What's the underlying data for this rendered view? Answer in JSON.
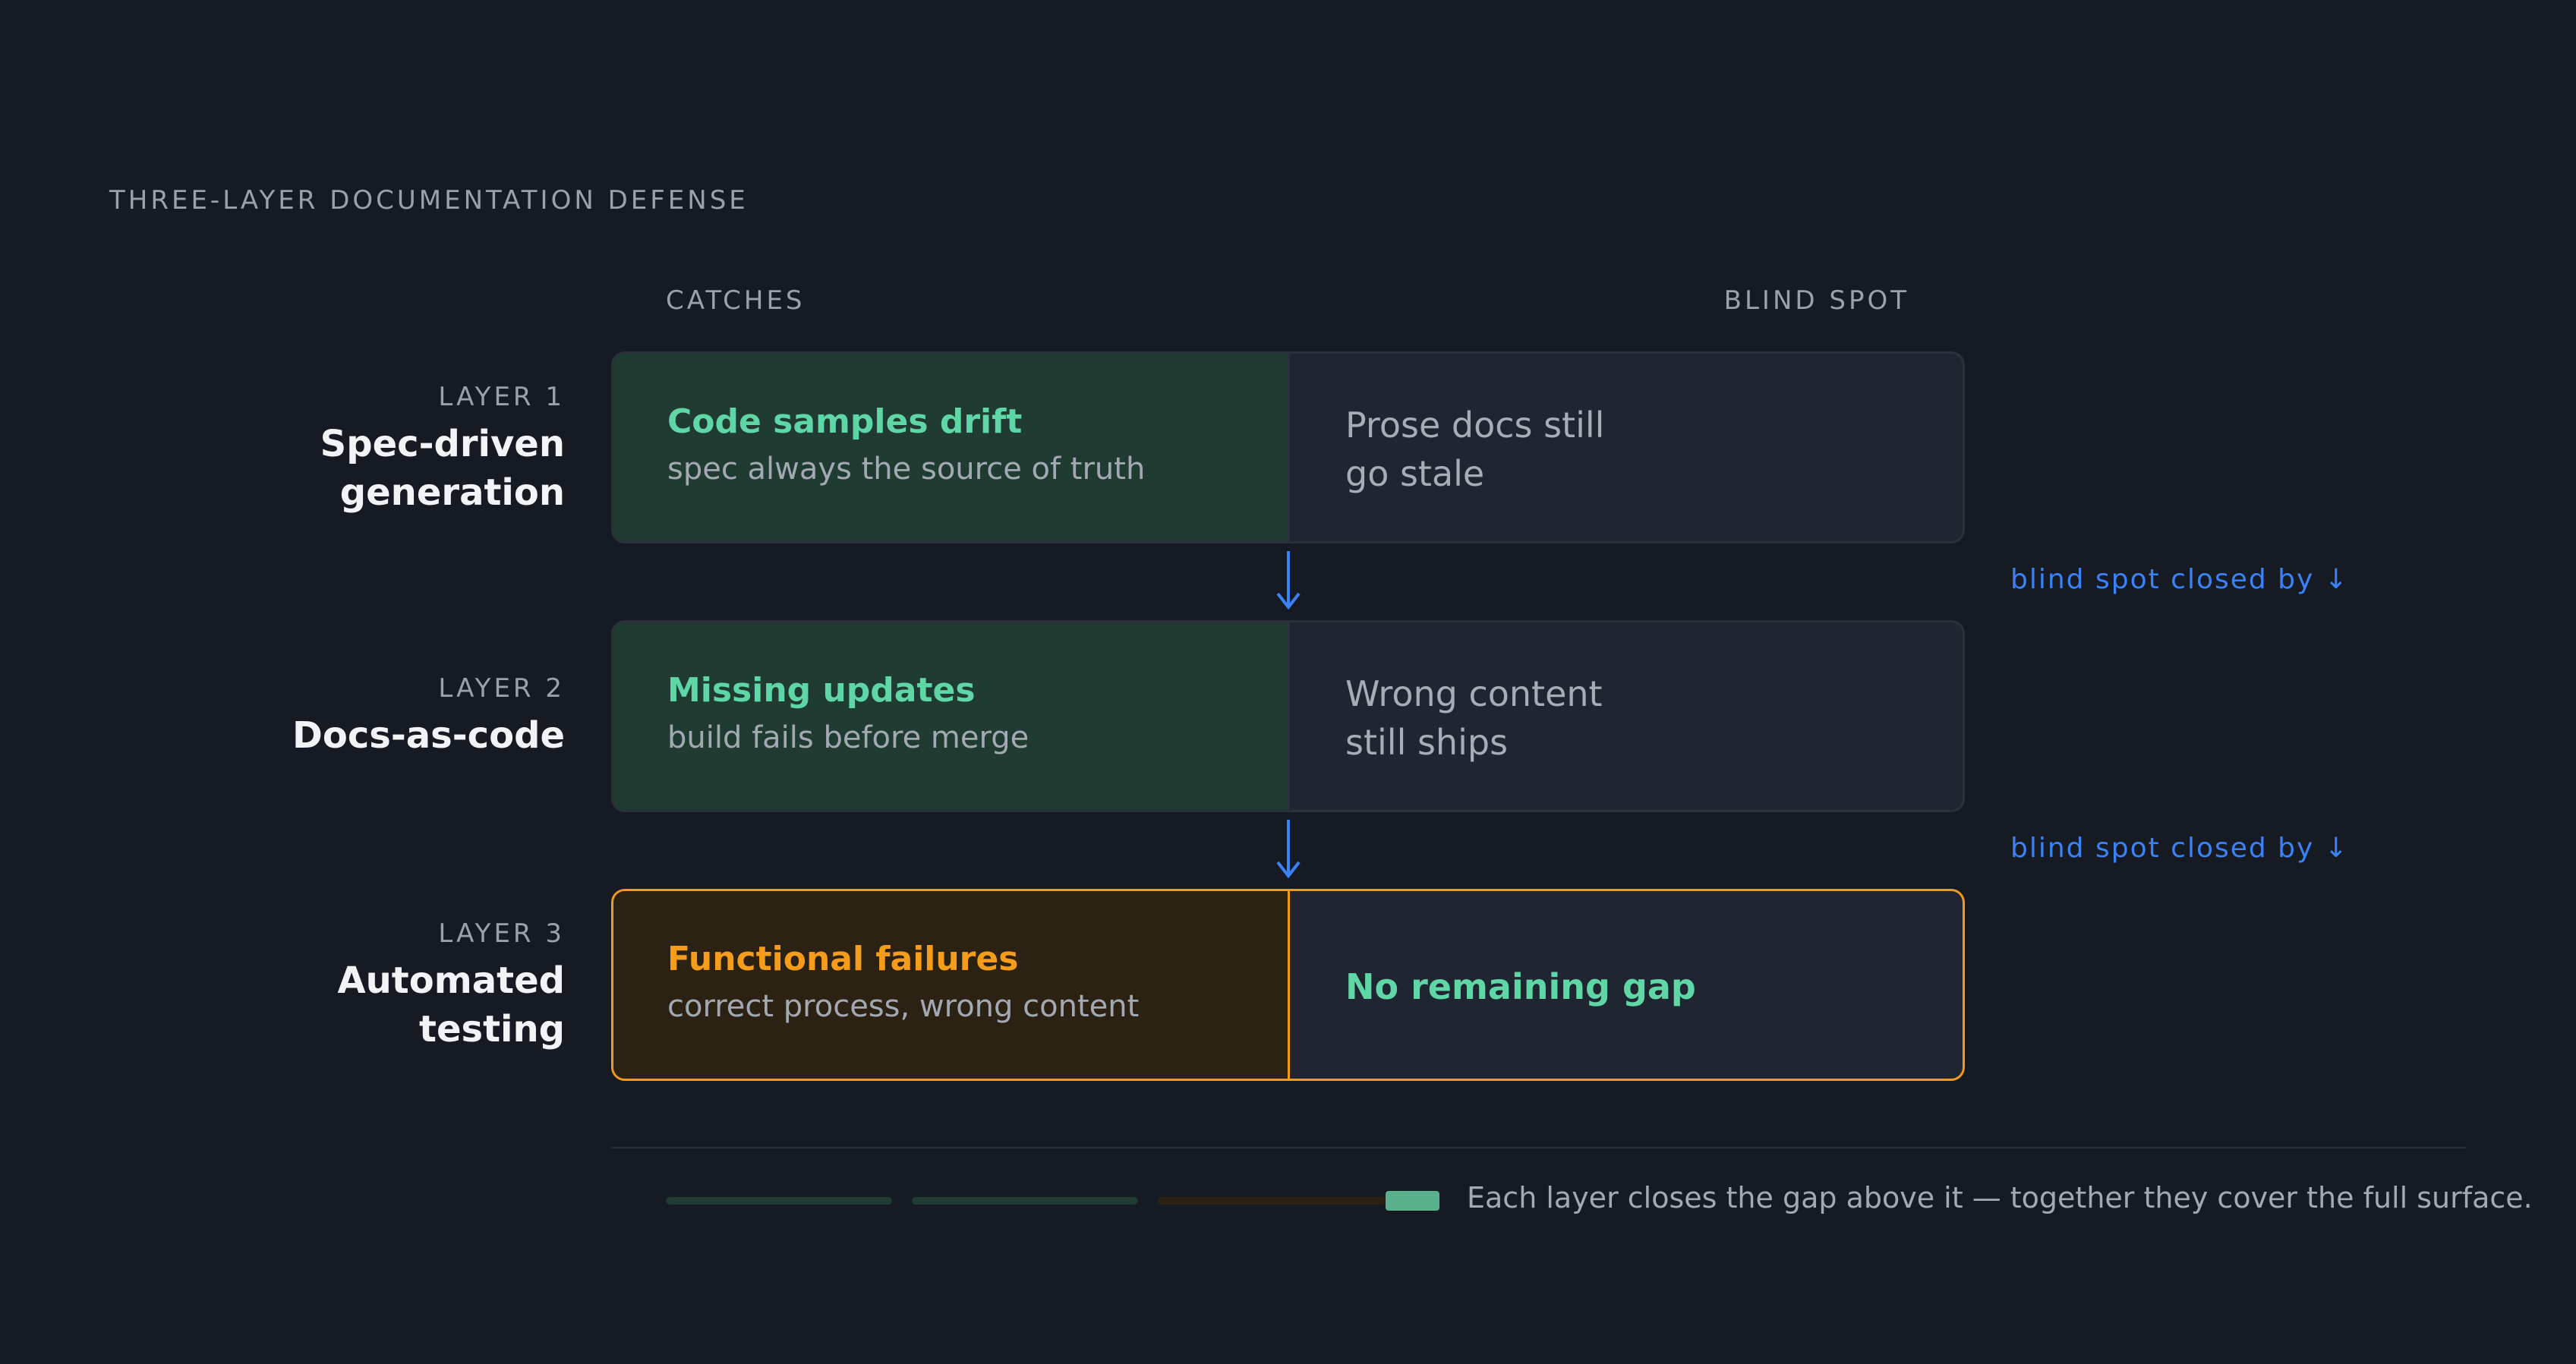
{
  "title": "THREE-LAYER DOCUMENTATION DEFENSE",
  "columns": {
    "catches": "CATCHES",
    "blind_spot": "BLIND SPOT"
  },
  "layers": [
    {
      "number": "LAYER 1",
      "name": "Spec-driven generation",
      "catch_title": "Code samples drift",
      "catch_sub": "spec always the source of truth",
      "blind_spot": "Prose docs still\ngo stale"
    },
    {
      "number": "LAYER 2",
      "name": "Docs-as-code",
      "catch_title": "Missing updates",
      "catch_sub": "build fails before merge",
      "blind_spot": "Wrong content\nstill ships"
    },
    {
      "number": "LAYER 3",
      "name": "Automated testing",
      "catch_title": "Functional failures",
      "catch_sub": "correct process, wrong content",
      "blind_spot": "No remaining gap"
    }
  ],
  "connector_label": "blind spot closed by ↓",
  "footer": "Each layer closes the gap above it — together they cover the full surface.",
  "colors": {
    "background": "#161a22",
    "catch_green": "#5fd6a5",
    "catch_orange": "#f59c1b",
    "connector_blue": "#3b82f6",
    "card_green": "#1f3b32",
    "card_orange": "#2c2214",
    "card_gray": "#1f2631"
  }
}
